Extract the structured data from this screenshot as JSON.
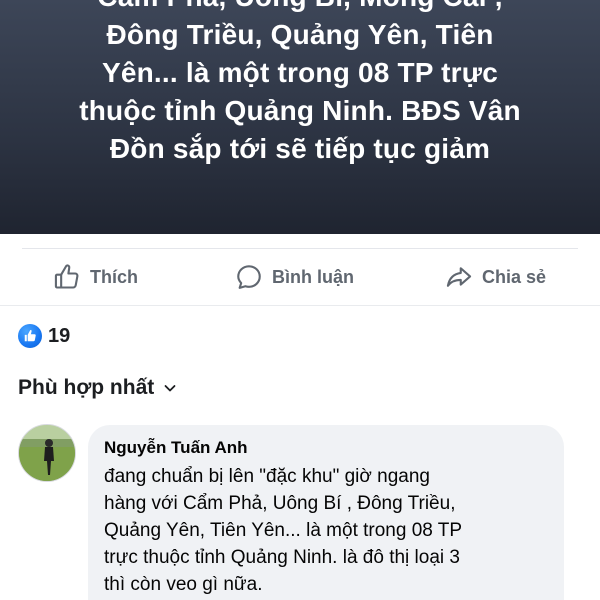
{
  "post": {
    "banner_lines": [
      "Cẩm Phả, Uông Bí, Móng Cái ,",
      "Đông Triều, Quảng Yên, Tiên",
      "Yên... là một trong 08 TP  trực",
      "thuộc tỉnh Quảng Ninh. BĐS Vân",
      "Đồn sắp tới sẽ tiếp tục giảm"
    ],
    "banner_colors": {
      "top": "#3d4658",
      "bottom": "#1f2430",
      "text": "#ffffff"
    }
  },
  "actions": {
    "like": {
      "label": "Thích",
      "icon": "thumbs-up-icon"
    },
    "comment": {
      "label": "Bình luận",
      "icon": "comment-bubble-icon"
    },
    "share": {
      "label": "Chia sẻ",
      "icon": "share-arrow-icon"
    }
  },
  "reactions": {
    "icon": "like-reaction-icon",
    "count": "19",
    "accent": "#1877f2"
  },
  "comments_sort": {
    "label": "Phù hợp nhất",
    "icon": "chevron-down-icon"
  },
  "comments": [
    {
      "author": "Nguyễn Tuấn Anh",
      "avatar_icon": "avatar-photo",
      "text_lines": [
        "đang chuẩn bị lên \"đặc khu\" giờ ngang",
        "hàng với Cẩm Phả, Uông Bí , Đông Triều,",
        "Quảng Yên, Tiên Yên... là một trong 08 TP",
        "trực thuộc tỉnh Quảng Ninh. là đô thị loại 3",
        "thì còn veo gì nữa."
      ]
    }
  ]
}
